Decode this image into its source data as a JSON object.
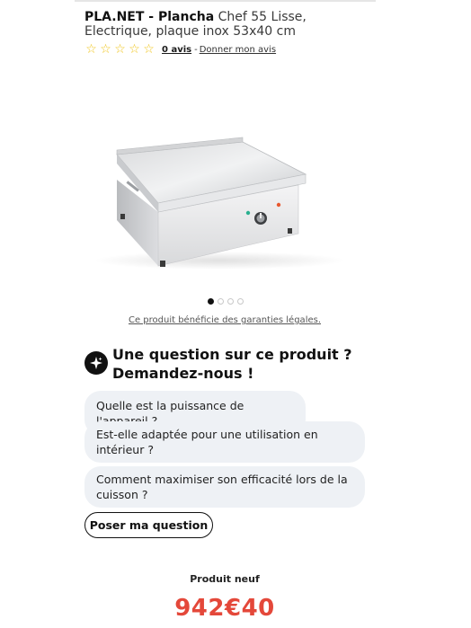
{
  "product": {
    "brand": "PLA.NET - Plancha",
    "name": " Chef 55 Lisse, Electrique, plaque inox 53x40 cm"
  },
  "rating": {
    "stars_filled": 0,
    "stars_total": 5,
    "count_label": "0 avis",
    "separator": "-",
    "review_link": "Donner mon avis"
  },
  "gallery": {
    "image_icon": "plancha-product-image",
    "slide_count": 4,
    "active_slide": 1
  },
  "guarantee_link": "Ce produit bénéficie des garanties légales.",
  "ask": {
    "title": "Une question sur ce produit ? Demandez-nous !",
    "icon": "sparkle-icon",
    "suggestions": [
      "Quelle est la puissance de l'appareil ?",
      "Est-elle adaptée pour une utilisation en intérieur ?",
      "Comment maximiser son efficacité lors de la cuisson ?"
    ],
    "button_label": "Poser ma question"
  },
  "offer": {
    "condition": "Produit neuf",
    "price": "942€40"
  },
  "colors": {
    "price": "#e4483a",
    "star": "#f0c419",
    "chip_bg": "#eef1f5"
  }
}
